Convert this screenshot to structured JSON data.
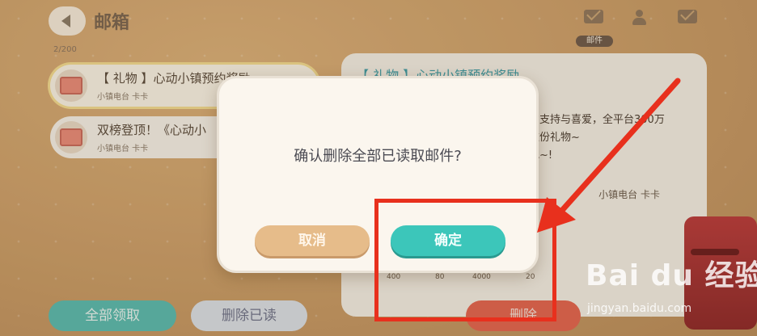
{
  "header": {
    "title": "邮箱",
    "mail_count": "2/200",
    "active_tab_label": "邮件"
  },
  "mail_list": [
    {
      "title": "【 礼物 】心动小镇预约奖励",
      "sender": "小镇电台 卡卡",
      "selected": true
    },
    {
      "title": "双榜登顶！《心动小",
      "sender": "小镇电台 卡卡",
      "selected": false
    }
  ],
  "detail": {
    "title": "【 礼物 】心动小镇预约奖励",
    "body_lines": [
      "的支持与喜爱，全平台300万",
      "这份礼物~",
      "吧~!"
    ],
    "sender": "小镇电台 卡卡",
    "attachments": [
      "400",
      "80",
      "4000",
      "20"
    ]
  },
  "bottom_buttons": {
    "claim_all": "全部领取",
    "delete_read": "删除已读",
    "delete": "删除"
  },
  "dialog": {
    "message": "确认删除全部已读取邮件?",
    "cancel": "取消",
    "confirm": "确定"
  },
  "annotation_color": "#e8301d",
  "accent_teal": "#3cc6ba",
  "watermark": {
    "brand": "Bai du 经验",
    "url": "jingyan.baidu.com"
  }
}
